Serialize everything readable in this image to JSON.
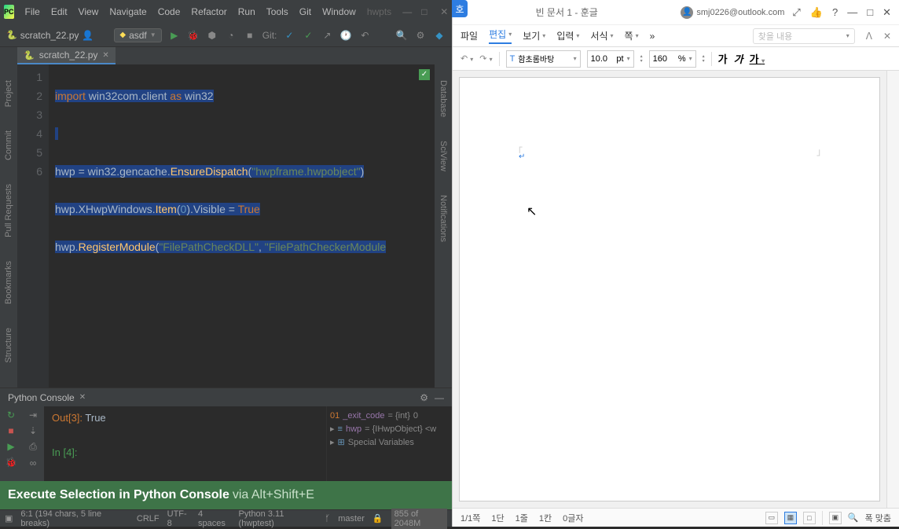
{
  "pycharm": {
    "logo": "PC",
    "menu": [
      "File",
      "Edit",
      "View",
      "Navigate",
      "Code",
      "Refactor",
      "Run",
      "Tools",
      "Git",
      "Window"
    ],
    "project_hint": "hwpts",
    "breadcrumb_file": "scratch_22.py",
    "run_config": "asdf",
    "git_label": "Git:",
    "tab": {
      "name": "scratch_22.py"
    },
    "left_tools": [
      "Project",
      "Commit",
      "Pull Requests",
      "Bookmarks",
      "Structure"
    ],
    "right_tools": [
      "Database",
      "SciView",
      "Notifications"
    ],
    "gutter": [
      "1",
      "2",
      "3",
      "4",
      "5",
      "6"
    ],
    "code": {
      "l1_import": "import",
      "l1_mod": " win32com.client ",
      "l1_as": "as",
      "l1_alias": " win32",
      "l3_a": "hwp = win32.gencache.",
      "l3_fn": "EnsureDispatch",
      "l3_p1": "(",
      "l3_s": "\"hwpframe.hwpobject\"",
      "l3_p2": ")",
      "l4_a": "hwp.XHwpWindows.",
      "l4_fn": "Item",
      "l4_p1": "(",
      "l4_n": "0",
      "l4_p2": ").Visible = ",
      "l4_true": "True",
      "l5_a": "hwp.",
      "l5_fn": "RegisterModule",
      "l5_p1": "(",
      "l5_s1": "\"FilePathCheckDLL\"",
      "l5_c": ", ",
      "l5_s2": "\"FilePathCheckerModule"
    },
    "console": {
      "title": "Python Console",
      "out_label": "Out[3]: ",
      "out_val": "True",
      "in_label": "In [4]:",
      "vars": {
        "exit_code_name": "_exit_code",
        "exit_code_type": " = {int} ",
        "exit_code_val": "0",
        "hwp_name": "hwp",
        "hwp_type": " = {IHwpObject} <w",
        "special": "Special Variables"
      }
    },
    "tooltip": {
      "main": "Execute Selection in Python Console",
      "via": " via Alt+Shift+E"
    },
    "status": {
      "pos": "6:1 (194 chars, 5 line breaks)",
      "crlf": "CRLF",
      "enc": "UTF-8",
      "indent": "4 spaces",
      "interp": "Python 3.11 (hwptest)",
      "branch": "master",
      "mem": "855 of 2048M"
    }
  },
  "hwp": {
    "handle": "호",
    "title": "빈 문서 1 - 훈글",
    "user": "smj0226@outlook.com",
    "menus": {
      "file": "파일",
      "edit": "편집",
      "view": "보기",
      "input": "입력",
      "format": "서식",
      "page": "쪽"
    },
    "search_placeholder": "찾을 내용",
    "toolbar": {
      "font": "함초롬바탕",
      "size": "10.0",
      "size_unit": "pt",
      "zoom": "160",
      "zoom_unit": "%",
      "bold": "가",
      "italic": "가",
      "underline": "가"
    },
    "status": {
      "page": "1/1쪽",
      "section": "1단",
      "line": "1줄",
      "col": "1칸",
      "chars": "0글자",
      "fit": "폭 맞춤"
    }
  }
}
